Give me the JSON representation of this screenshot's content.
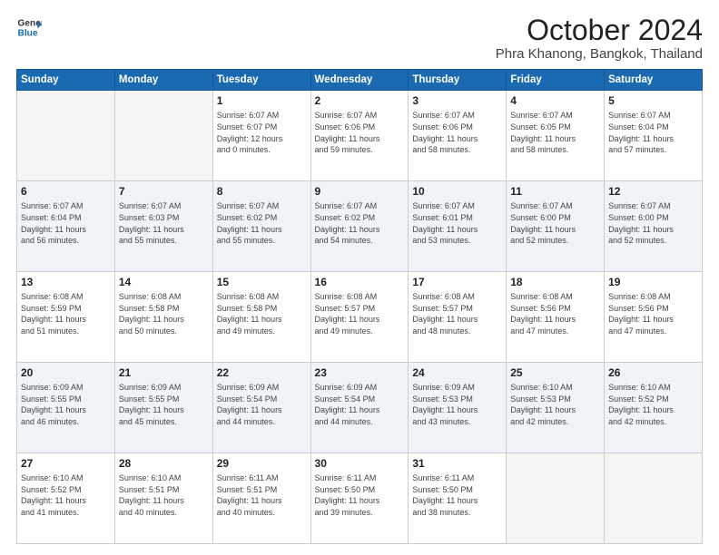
{
  "header": {
    "logo_line1": "General",
    "logo_line2": "Blue",
    "title": "October 2024",
    "subtitle": "Phra Khanong, Bangkok, Thailand"
  },
  "weekdays": [
    "Sunday",
    "Monday",
    "Tuesday",
    "Wednesday",
    "Thursday",
    "Friday",
    "Saturday"
  ],
  "weeks": [
    [
      {
        "day": "",
        "info": ""
      },
      {
        "day": "",
        "info": ""
      },
      {
        "day": "1",
        "info": "Sunrise: 6:07 AM\nSunset: 6:07 PM\nDaylight: 12 hours\nand 0 minutes."
      },
      {
        "day": "2",
        "info": "Sunrise: 6:07 AM\nSunset: 6:06 PM\nDaylight: 11 hours\nand 59 minutes."
      },
      {
        "day": "3",
        "info": "Sunrise: 6:07 AM\nSunset: 6:06 PM\nDaylight: 11 hours\nand 58 minutes."
      },
      {
        "day": "4",
        "info": "Sunrise: 6:07 AM\nSunset: 6:05 PM\nDaylight: 11 hours\nand 58 minutes."
      },
      {
        "day": "5",
        "info": "Sunrise: 6:07 AM\nSunset: 6:04 PM\nDaylight: 11 hours\nand 57 minutes."
      }
    ],
    [
      {
        "day": "6",
        "info": "Sunrise: 6:07 AM\nSunset: 6:04 PM\nDaylight: 11 hours\nand 56 minutes."
      },
      {
        "day": "7",
        "info": "Sunrise: 6:07 AM\nSunset: 6:03 PM\nDaylight: 11 hours\nand 55 minutes."
      },
      {
        "day": "8",
        "info": "Sunrise: 6:07 AM\nSunset: 6:02 PM\nDaylight: 11 hours\nand 55 minutes."
      },
      {
        "day": "9",
        "info": "Sunrise: 6:07 AM\nSunset: 6:02 PM\nDaylight: 11 hours\nand 54 minutes."
      },
      {
        "day": "10",
        "info": "Sunrise: 6:07 AM\nSunset: 6:01 PM\nDaylight: 11 hours\nand 53 minutes."
      },
      {
        "day": "11",
        "info": "Sunrise: 6:07 AM\nSunset: 6:00 PM\nDaylight: 11 hours\nand 52 minutes."
      },
      {
        "day": "12",
        "info": "Sunrise: 6:07 AM\nSunset: 6:00 PM\nDaylight: 11 hours\nand 52 minutes."
      }
    ],
    [
      {
        "day": "13",
        "info": "Sunrise: 6:08 AM\nSunset: 5:59 PM\nDaylight: 11 hours\nand 51 minutes."
      },
      {
        "day": "14",
        "info": "Sunrise: 6:08 AM\nSunset: 5:58 PM\nDaylight: 11 hours\nand 50 minutes."
      },
      {
        "day": "15",
        "info": "Sunrise: 6:08 AM\nSunset: 5:58 PM\nDaylight: 11 hours\nand 49 minutes."
      },
      {
        "day": "16",
        "info": "Sunrise: 6:08 AM\nSunset: 5:57 PM\nDaylight: 11 hours\nand 49 minutes."
      },
      {
        "day": "17",
        "info": "Sunrise: 6:08 AM\nSunset: 5:57 PM\nDaylight: 11 hours\nand 48 minutes."
      },
      {
        "day": "18",
        "info": "Sunrise: 6:08 AM\nSunset: 5:56 PM\nDaylight: 11 hours\nand 47 minutes."
      },
      {
        "day": "19",
        "info": "Sunrise: 6:08 AM\nSunset: 5:56 PM\nDaylight: 11 hours\nand 47 minutes."
      }
    ],
    [
      {
        "day": "20",
        "info": "Sunrise: 6:09 AM\nSunset: 5:55 PM\nDaylight: 11 hours\nand 46 minutes."
      },
      {
        "day": "21",
        "info": "Sunrise: 6:09 AM\nSunset: 5:55 PM\nDaylight: 11 hours\nand 45 minutes."
      },
      {
        "day": "22",
        "info": "Sunrise: 6:09 AM\nSunset: 5:54 PM\nDaylight: 11 hours\nand 44 minutes."
      },
      {
        "day": "23",
        "info": "Sunrise: 6:09 AM\nSunset: 5:54 PM\nDaylight: 11 hours\nand 44 minutes."
      },
      {
        "day": "24",
        "info": "Sunrise: 6:09 AM\nSunset: 5:53 PM\nDaylight: 11 hours\nand 43 minutes."
      },
      {
        "day": "25",
        "info": "Sunrise: 6:10 AM\nSunset: 5:53 PM\nDaylight: 11 hours\nand 42 minutes."
      },
      {
        "day": "26",
        "info": "Sunrise: 6:10 AM\nSunset: 5:52 PM\nDaylight: 11 hours\nand 42 minutes."
      }
    ],
    [
      {
        "day": "27",
        "info": "Sunrise: 6:10 AM\nSunset: 5:52 PM\nDaylight: 11 hours\nand 41 minutes."
      },
      {
        "day": "28",
        "info": "Sunrise: 6:10 AM\nSunset: 5:51 PM\nDaylight: 11 hours\nand 40 minutes."
      },
      {
        "day": "29",
        "info": "Sunrise: 6:11 AM\nSunset: 5:51 PM\nDaylight: 11 hours\nand 40 minutes."
      },
      {
        "day": "30",
        "info": "Sunrise: 6:11 AM\nSunset: 5:50 PM\nDaylight: 11 hours\nand 39 minutes."
      },
      {
        "day": "31",
        "info": "Sunrise: 6:11 AM\nSunset: 5:50 PM\nDaylight: 11 hours\nand 38 minutes."
      },
      {
        "day": "",
        "info": ""
      },
      {
        "day": "",
        "info": ""
      }
    ]
  ]
}
